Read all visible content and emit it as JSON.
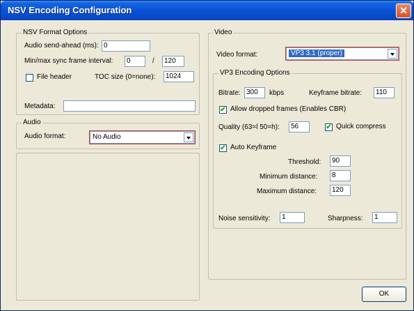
{
  "window": {
    "title": "NSV Encoding Configuration",
    "close_glyph": "✕"
  },
  "nsv": {
    "group_label": "NSV Format Options",
    "sendahead_label": "Audio send-ahead (ms):",
    "sendahead_value": "0",
    "sync_label": "Min/max sync frame interval:",
    "sync_min": "0",
    "sync_sep": "/",
    "sync_max": "120",
    "fileheader_label": "File header",
    "fileheader_checked": false,
    "toc_label": "TOC size (0=none):",
    "toc_value": "1024",
    "metadata_label": "Metadata:",
    "metadata_value": ""
  },
  "audio": {
    "group_label": "Audio",
    "format_label": "Audio format:",
    "format_value": "No Audio"
  },
  "video": {
    "group_label": "Video",
    "format_label": "Video format:",
    "format_value": "VP3 3.1 (proper)"
  },
  "vp3": {
    "group_label": "VP3 Encoding Options",
    "bitrate_label": "Bitrate:",
    "bitrate_value": "300",
    "bitrate_unit": "kbps",
    "kf_bitrate_label": "Keyframe bitrate:",
    "kf_bitrate_value": "110",
    "dropped_label": "Allow dropped frames (Enables CBR)",
    "dropped_checked": true,
    "quality_label": "Quality (63=l 50=h):",
    "quality_value": "56",
    "quick_label": "Quick compress",
    "quick_checked": true,
    "autokf_label": "Auto Keyframe",
    "autokf_checked": true,
    "threshold_label": "Threshold:",
    "threshold_value": "90",
    "min_dist_label": "Minimum distance:",
    "min_dist_value": "8",
    "max_dist_label": "Maximum distance:",
    "max_dist_value": "120",
    "noise_label": "Noise sensitivity:",
    "noise_value": "1",
    "sharp_label": "Sharpness:",
    "sharp_value": "1"
  },
  "buttons": {
    "ok_label": "OK"
  },
  "check_glyph": "✔"
}
